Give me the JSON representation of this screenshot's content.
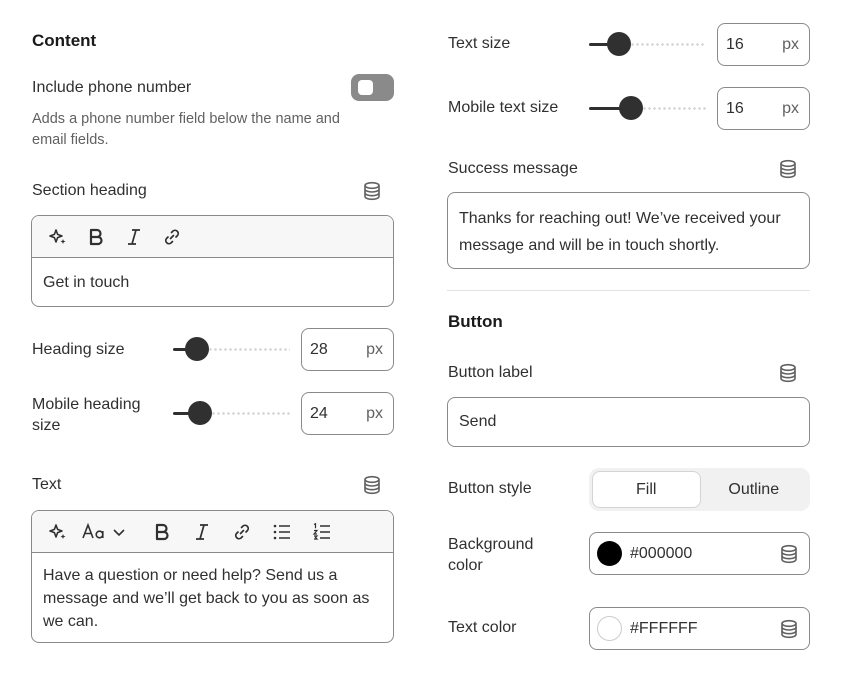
{
  "left": {
    "section_title": "Content",
    "phone": {
      "label": "Include phone number",
      "enabled": false,
      "help": "Adds a phone number field below the name and email fields."
    },
    "heading": {
      "label": "Section heading",
      "value": "Get in touch"
    },
    "heading_size": {
      "label": "Heading size",
      "value": "28",
      "unit": "px",
      "fraction": 0.2
    },
    "mobile_heading_size": {
      "label": "Mobile heading size",
      "value": "24",
      "unit": "px",
      "fraction": 0.23
    },
    "text": {
      "label": "Text",
      "value": "Have a question or need help? Send us a message and we’ll get back to you as soon as we can."
    }
  },
  "right": {
    "text_size": {
      "label": "Text size",
      "value": "16",
      "unit": "px",
      "fraction": 0.25
    },
    "mobile_text_size": {
      "label": "Mobile text size",
      "value": "16",
      "unit": "px",
      "fraction": 0.35
    },
    "success": {
      "label": "Success message",
      "value": "Thanks for reaching out! We’ve received your message and will be in touch shortly."
    },
    "button_section_title": "Button",
    "button_label": {
      "label": "Button label",
      "value": "Send"
    },
    "button_style": {
      "label": "Button style",
      "options": [
        "Fill",
        "Outline"
      ],
      "selected": "Fill"
    },
    "background_color": {
      "label": "Background color",
      "value": "#000000",
      "swatch": "#000000"
    },
    "text_color": {
      "label": "Text color",
      "value": "#FFFFFF",
      "swatch": "#FFFFFF"
    }
  },
  "icons": {
    "db": "database-icon",
    "sparkle": "sparkle-icon",
    "bold": "bold-icon",
    "italic": "italic-icon",
    "link": "link-icon",
    "font": "font-icon",
    "bullets": "bullet-list-icon",
    "numbers": "numbered-list-icon"
  }
}
